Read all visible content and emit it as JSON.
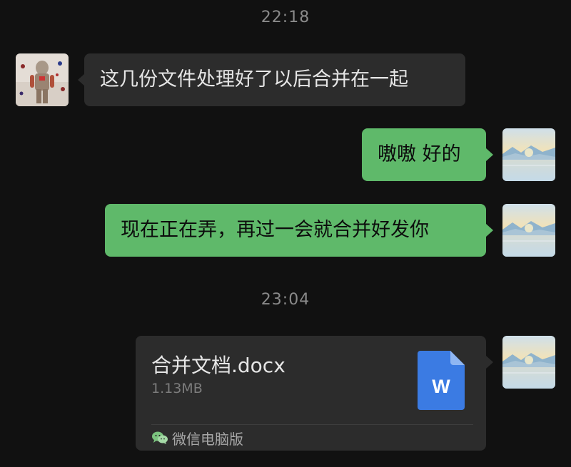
{
  "timestamps": [
    "22:18",
    "23:04"
  ],
  "messages": [
    {
      "direction": "incoming",
      "text": "这几份文件处理好了以后合并在一起"
    },
    {
      "direction": "outgoing",
      "text": "嗷嗷 好的"
    },
    {
      "direction": "outgoing",
      "text": "现在正在弄，再过一会就合并好发你"
    }
  ],
  "file": {
    "name": "合并文档.docx",
    "size": "1.13MB",
    "icon_letter": "W",
    "source": "微信电脑版",
    "icon": "word-document-icon",
    "source_icon": "wechat-icon"
  },
  "colors": {
    "background": "#111111",
    "incoming_bubble": "#2c2c2c",
    "outgoing_bubble": "#5fb96a",
    "word_blue": "#3b7be3"
  }
}
